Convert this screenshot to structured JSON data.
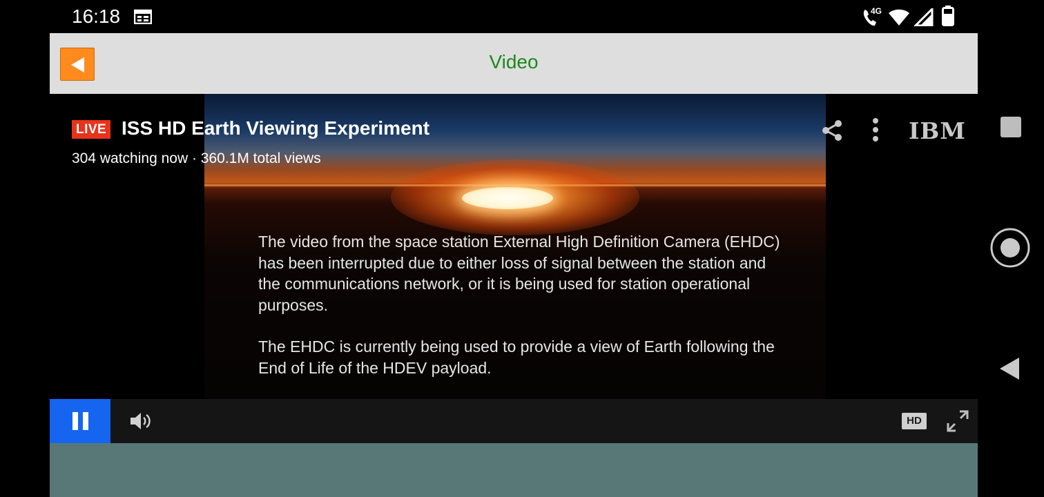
{
  "status_bar": {
    "time": "16:18",
    "network_label": "4G",
    "icons": [
      "calendar-icon",
      "wifi-call-icon",
      "wifi-icon",
      "cell-signal-icon",
      "battery-icon"
    ]
  },
  "app_bar": {
    "back_icon": "back-arrow-icon",
    "title": "Video",
    "colors": {
      "bar": "#dedede",
      "title": "#1a8a1a",
      "back_button": "#ff8b1e"
    }
  },
  "player": {
    "live_label": "LIVE",
    "title": "ISS HD Earth Viewing Experiment",
    "stats": "304 watching now · 360.1M total views",
    "brand": "IBM",
    "message_paragraphs": [
      "The video from the space station External High Definition Camera (EHDC) has been interrupted due to either loss of signal between the station and the communications network, or it is being used for station operational purposes.",
      "The EHDC is currently being used to provide a view of Earth following the End of Life of the HDEV payload."
    ],
    "colors": {
      "live_badge": "#e8331b",
      "pause_button": "#1565f0"
    }
  },
  "controls": {
    "quality": "HD",
    "icons": [
      "pause-icon",
      "volume-icon",
      "fullscreen-icon"
    ]
  },
  "nav_bar": {
    "icons": [
      "stop-icon",
      "home-icon",
      "back-icon"
    ]
  }
}
